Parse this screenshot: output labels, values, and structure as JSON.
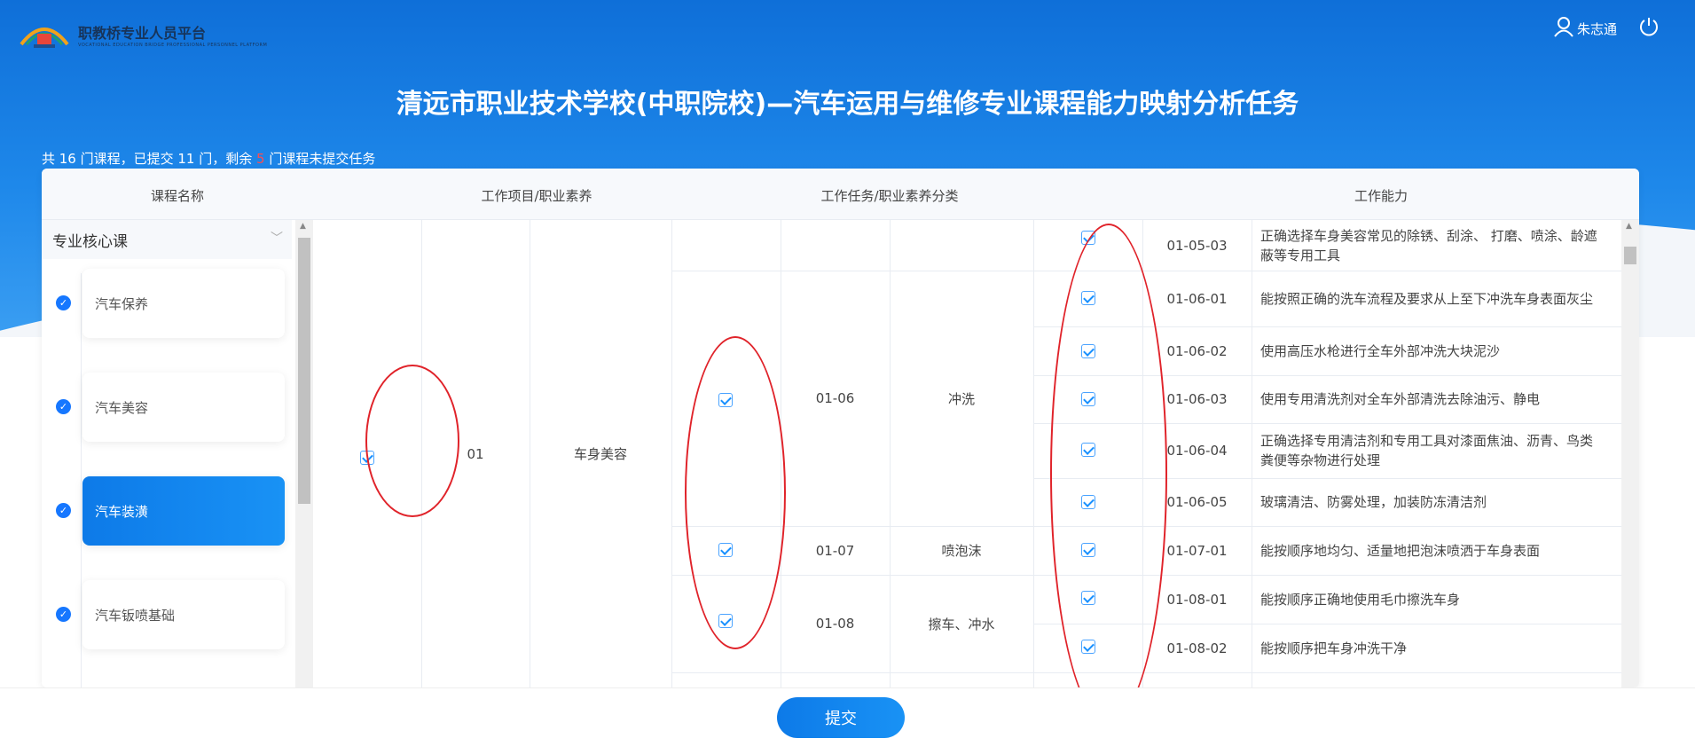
{
  "header": {
    "logo_title": "职教桥专业人员平台",
    "logo_subtitle": "VOCATIONAL EDUCATION BRIDGE PROFESSIONAL PERSONNEL PLATFORM",
    "user_name": "朱志通"
  },
  "page_title": "清远市职业技术学校(中职院校)—汽车运用与维修专业课程能力映射分析任务",
  "summary": {
    "prefix": "共 16 门课程，已提交 11 门，剩余 ",
    "remaining": "5",
    "suffix": " 门课程未提交任务"
  },
  "table_headers": {
    "course": "课程名称",
    "project": "工作项目/职业素养",
    "task": "工作任务/职业素养分类",
    "ability": "工作能力"
  },
  "sidebar": {
    "category": "专业核心课",
    "courses": [
      {
        "label": "汽车保养",
        "active": false
      },
      {
        "label": "汽车美容",
        "active": false
      },
      {
        "label": "汽车装潢",
        "active": true
      },
      {
        "label": "汽车钣喷基础",
        "active": false
      }
    ]
  },
  "project": {
    "code": "01",
    "name": "车身美容",
    "checked": true
  },
  "tasks": [
    {
      "code": "01-06",
      "name": "冲洗",
      "checked": true
    },
    {
      "code": "01-07",
      "name": "喷泡沫",
      "checked": true
    },
    {
      "code": "01-08",
      "name": "擦车、冲水",
      "checked": true
    }
  ],
  "abilities": [
    {
      "code": "01-05-03",
      "text": "正确选择车身美容常见的除锈、刮涂、 打磨、喷涂、龄遮蔽等专用工具",
      "checked": true
    },
    {
      "code": "01-06-01",
      "text": "能按照正确的洗车流程及要求从上至下冲洗车身表面灰尘",
      "checked": true
    },
    {
      "code": "01-06-02",
      "text": "使用高压水枪进行全车外部冲洗大块泥沙",
      "checked": true
    },
    {
      "code": "01-06-03",
      "text": "使用专用清洗剂对全车外部清洗去除油污、静电",
      "checked": true
    },
    {
      "code": "01-06-04",
      "text": "正确选择专用清洁剂和专用工具对漆面焦油、沥青、鸟类粪便等杂物进行处理",
      "checked": true
    },
    {
      "code": "01-06-05",
      "text": "玻璃清洁、防雾处理，加装防冻清洁剂",
      "checked": true
    },
    {
      "code": "01-07-01",
      "text": "能按顺序地均匀、适量地把泡沫喷洒于车身表面",
      "checked": true
    },
    {
      "code": "01-08-01",
      "text": "能按顺序正确地使用毛巾擦洗车身",
      "checked": true
    },
    {
      "code": "01-08-02",
      "text": "能按顺序把车身冲洗干净",
      "checked": true
    }
  ],
  "footer": {
    "submit_label": "提交"
  },
  "colors": {
    "primary": "#1677ff",
    "annotation": "#e0232a"
  }
}
